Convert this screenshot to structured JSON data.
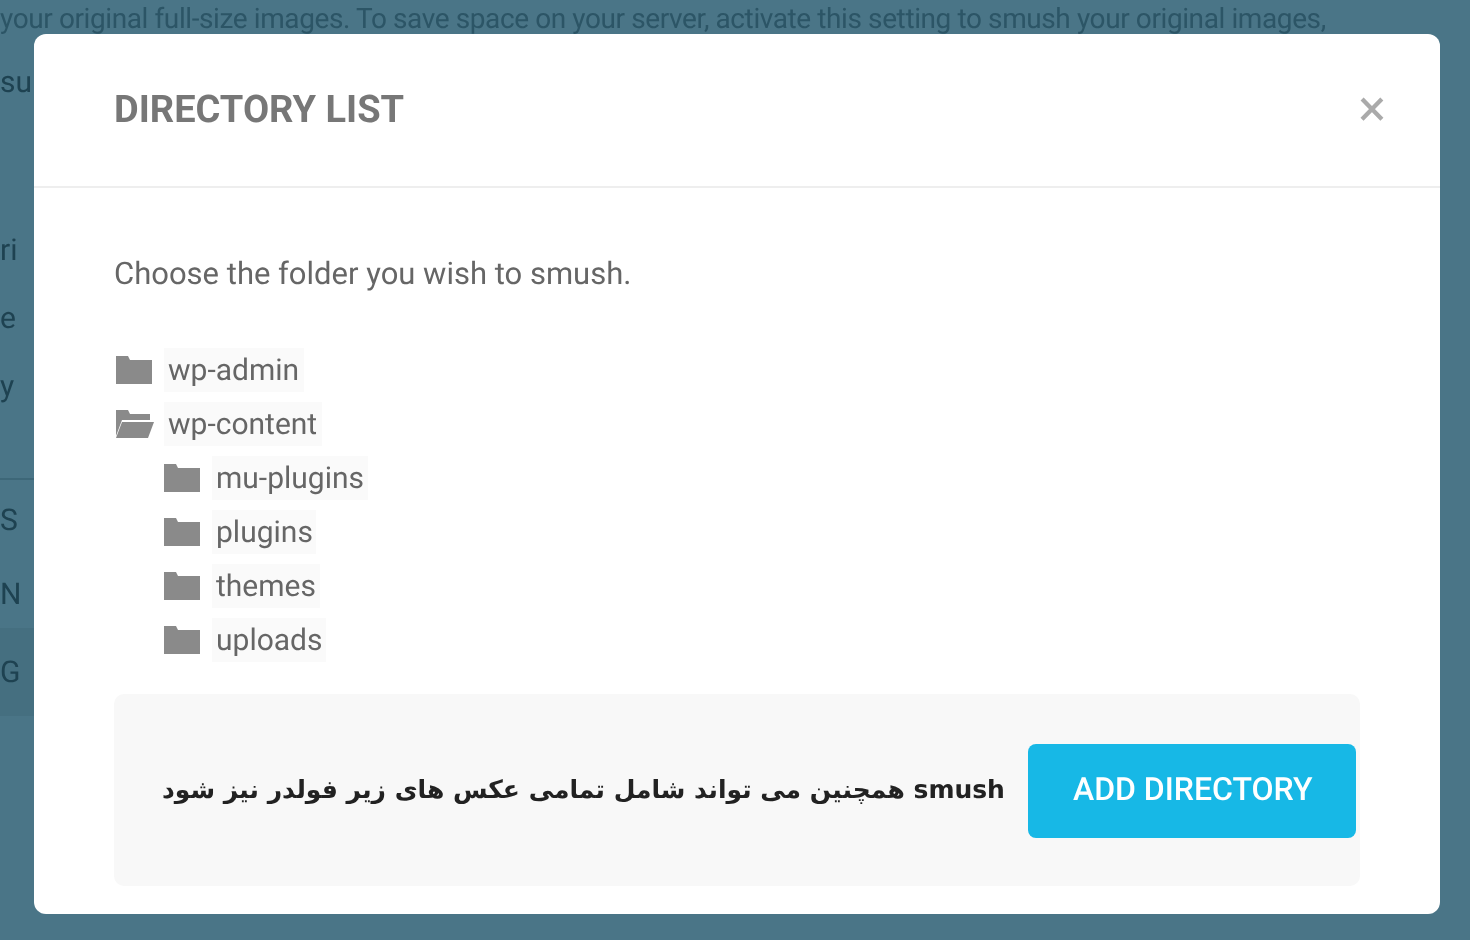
{
  "background": {
    "top_line": "your original full-size images. To save space on your server, activate this setting to smush your original images,",
    "fragments": [
      "su",
      "ri",
      "e",
      "y",
      "S",
      "N",
      "G"
    ]
  },
  "dialog": {
    "title": "DIRECTORY LIST",
    "close": "×",
    "prompt": "Choose the folder you wish to smush.",
    "tree": [
      {
        "label": "wp-admin",
        "open": false
      },
      {
        "label": "wp-content",
        "open": true,
        "children": [
          {
            "label": "mu-plugins",
            "open": false
          },
          {
            "label": "plugins",
            "open": false
          },
          {
            "label": "themes",
            "open": false
          },
          {
            "label": "uploads",
            "open": false
          }
        ]
      }
    ],
    "footer_note": "smush همچنین می تواند شامل تمامی عکس های زیر فولدر نیز شود",
    "button": "ADD DIRECTORY"
  }
}
